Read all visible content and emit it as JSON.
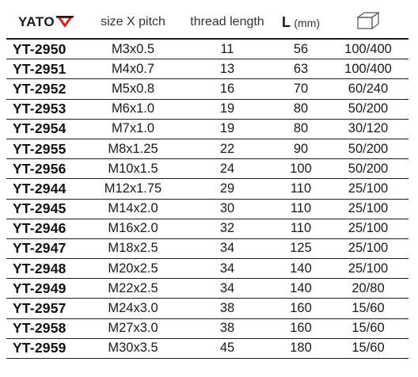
{
  "brand": "YATO",
  "headers": {
    "size": "size X pitch",
    "thread": "thread length",
    "length_letter": "L",
    "length_unit": "(mm)",
    "package_icon": "box-icon"
  },
  "rows": [
    {
      "code": "YT-2950",
      "size": "M3x0.5",
      "thread": "11",
      "length": "56",
      "pack": "100/400"
    },
    {
      "code": "YT-2951",
      "size": "M4x0.7",
      "thread": "13",
      "length": "63",
      "pack": "100/400"
    },
    {
      "code": "YT-2952",
      "size": "M5x0.8",
      "thread": "16",
      "length": "70",
      "pack": "60/240"
    },
    {
      "code": "YT-2953",
      "size": "M6x1.0",
      "thread": "19",
      "length": "80",
      "pack": "50/200"
    },
    {
      "code": "YT-2954",
      "size": "M7x1.0",
      "thread": "19",
      "length": "80",
      "pack": "30/120"
    },
    {
      "code": "YT-2955",
      "size": "M8x1.25",
      "thread": "22",
      "length": "90",
      "pack": "50/200"
    },
    {
      "code": "YT-2956",
      "size": "M10x1.5",
      "thread": "24",
      "length": "100",
      "pack": "50/200"
    },
    {
      "code": "YT-2944",
      "size": "M12x1.75",
      "thread": "29",
      "length": "110",
      "pack": "25/100"
    },
    {
      "code": "YT-2945",
      "size": "M14x2.0",
      "thread": "30",
      "length": "110",
      "pack": "25/100"
    },
    {
      "code": "YT-2946",
      "size": "M16x2.0",
      "thread": "32",
      "length": "110",
      "pack": "25/100"
    },
    {
      "code": "YT-2947",
      "size": "M18x2.5",
      "thread": "34",
      "length": "125",
      "pack": "25/100"
    },
    {
      "code": "YT-2948",
      "size": "M20x2.5",
      "thread": "34",
      "length": "140",
      "pack": "25/100"
    },
    {
      "code": "YT-2949",
      "size": "M22x2.5",
      "thread": "34",
      "length": "140",
      "pack": "20/80"
    },
    {
      "code": "YT-2957",
      "size": "M24x3.0",
      "thread": "38",
      "length": "160",
      "pack": "15/60"
    },
    {
      "code": "YT-2958",
      "size": "M27x3.0",
      "thread": "38",
      "length": "160",
      "pack": "15/60"
    },
    {
      "code": "YT-2959",
      "size": "M30x3.5",
      "thread": "45",
      "length": "180",
      "pack": "15/60"
    }
  ]
}
